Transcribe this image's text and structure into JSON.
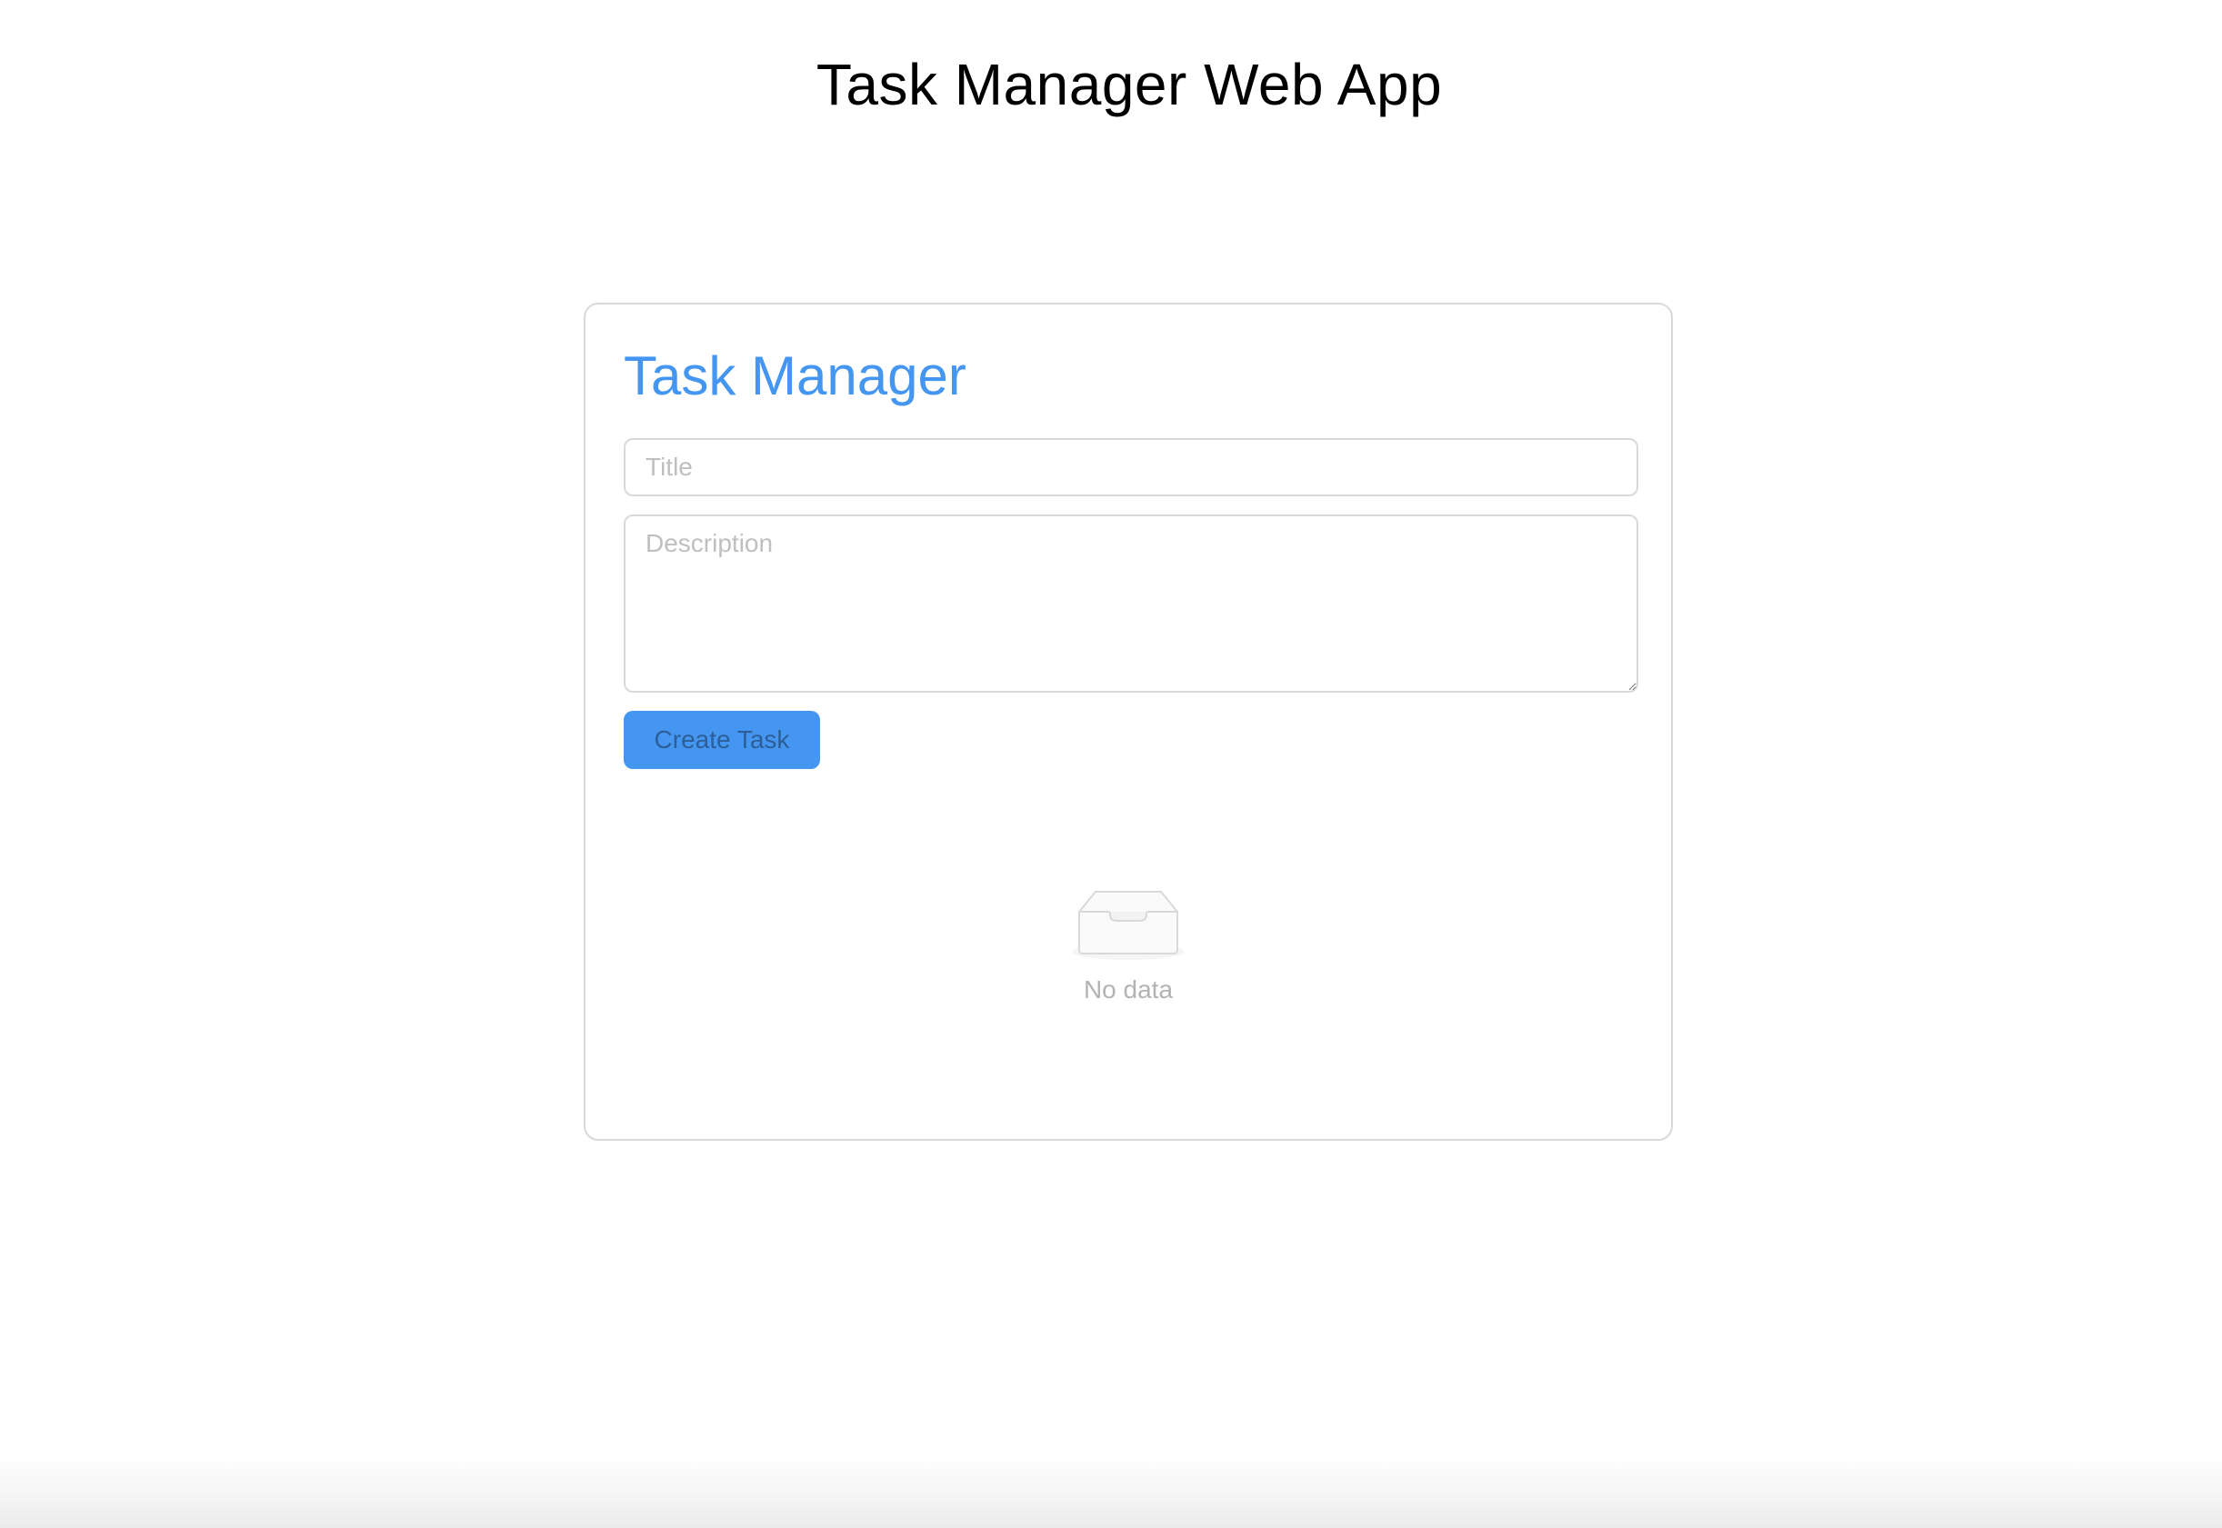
{
  "header": {
    "title": "Task Manager Web App"
  },
  "card": {
    "title": "Task Manager",
    "title_color": "#4596f0",
    "form": {
      "title_placeholder": "Title",
      "title_value": "",
      "description_placeholder": "Description",
      "description_value": "",
      "create_button_label": "Create Task"
    },
    "empty_state": {
      "icon": "empty-inbox-icon",
      "text": "No data"
    }
  },
  "colors": {
    "accent": "#4596f0",
    "border": "#d9d9d9",
    "muted_text": "#b3b3b3"
  }
}
